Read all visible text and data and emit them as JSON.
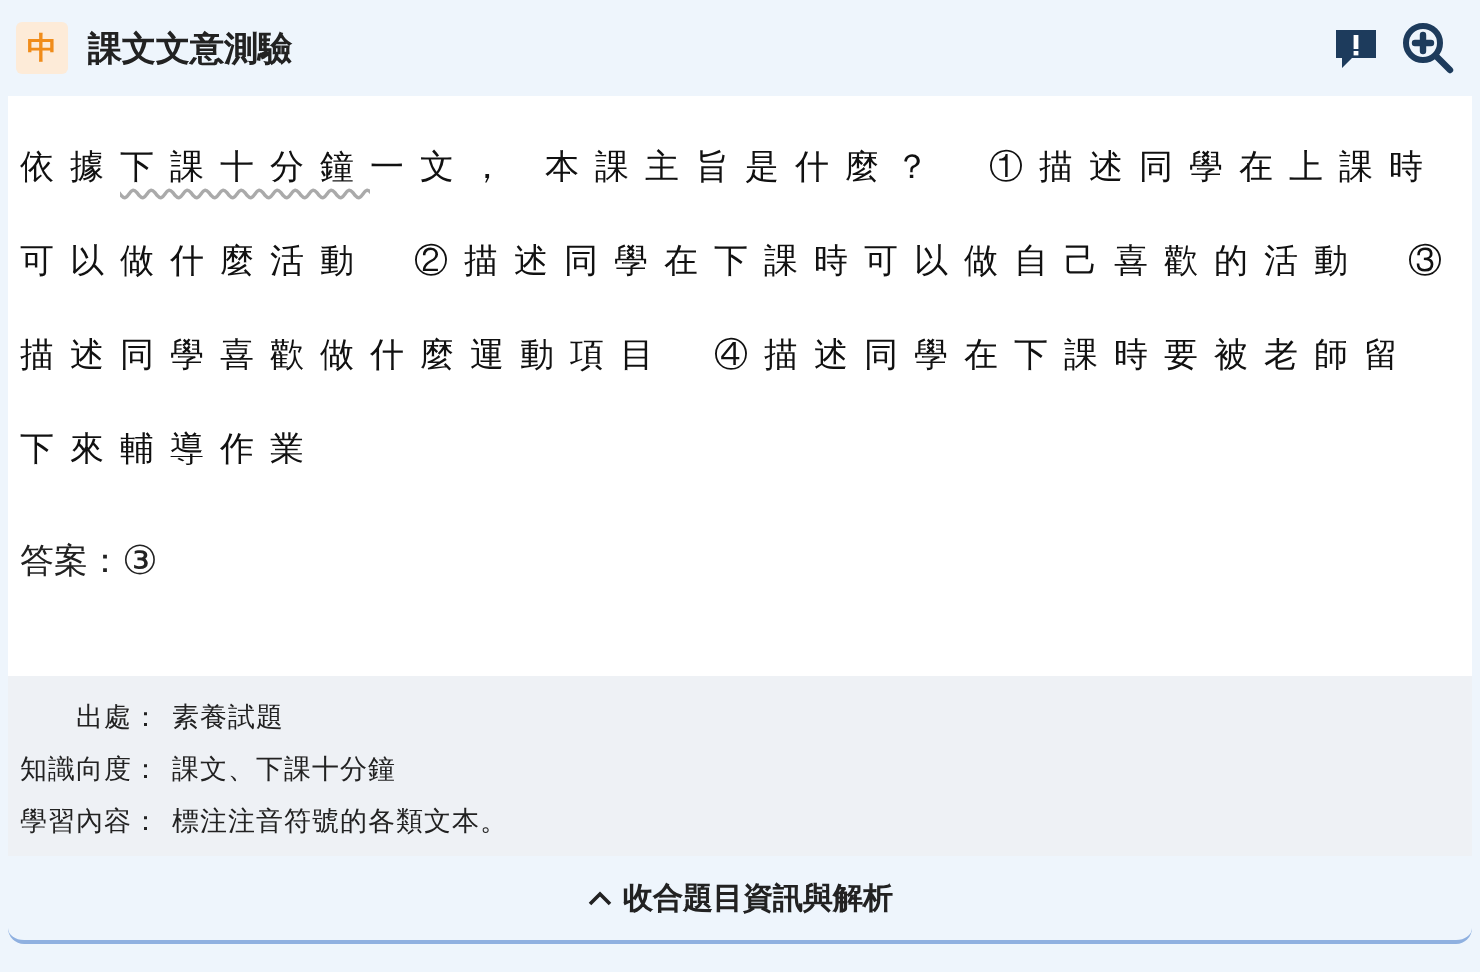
{
  "header": {
    "badge": "中",
    "title": "課文文意測驗"
  },
  "question": {
    "segments": [
      {
        "kind": "plain",
        "text": "依據"
      },
      {
        "kind": "title",
        "text": "下課十分鐘"
      },
      {
        "kind": "plain",
        "text": "一文， 本課主旨是什麼？"
      }
    ],
    "options": [
      "①描述同學在上課時可以做什麼活動",
      "②描述同學在下課時可以做自己喜歡的活動",
      "③描述同學喜歡做什麼運動項目",
      "④描述同學在下課時要被老師留下來輔導作業"
    ]
  },
  "answer": {
    "label": "答案：",
    "value": "③"
  },
  "info": [
    {
      "label": "出處：",
      "value": "素養試題"
    },
    {
      "label": "知識向度：",
      "value": "課文、下課十分鐘"
    },
    {
      "label": "學習內容：",
      "value": "標注注音符號的各類文本。"
    }
  ],
  "collapse_button": {
    "label": "收合題目資訊與解析"
  }
}
